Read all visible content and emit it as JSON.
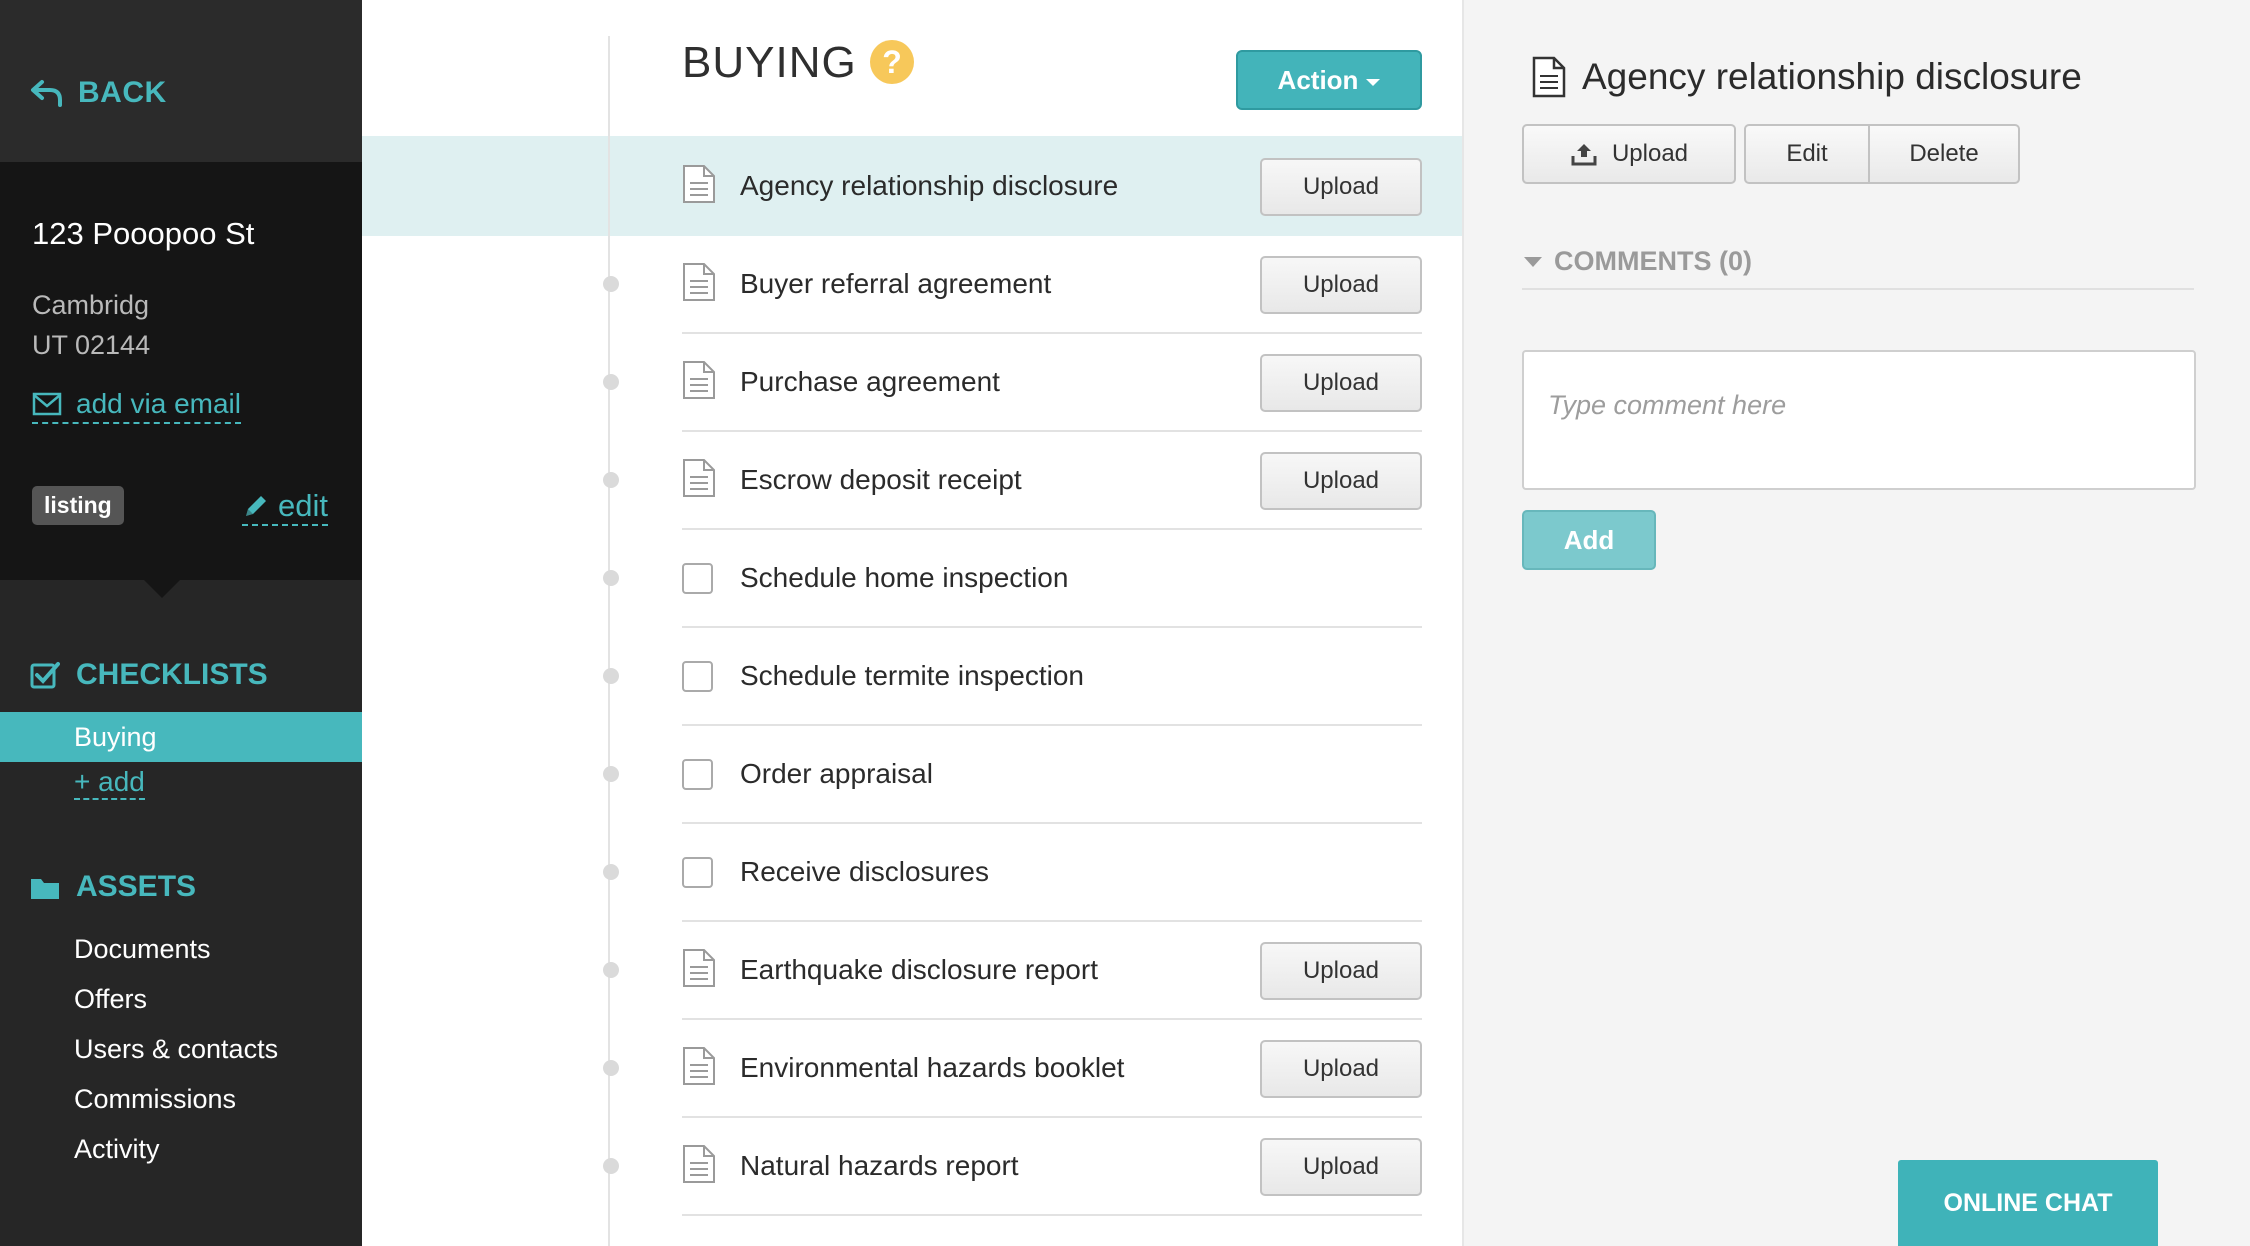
{
  "sidebar": {
    "back_label": "BACK",
    "property": {
      "street": "123 Pooopoo St",
      "city": "Cambridg",
      "state_zip": "UT 02144",
      "email_link": "add via email",
      "badge": "listing",
      "edit_label": "edit"
    },
    "checklists": {
      "title": "CHECKLISTS",
      "items": [
        {
          "label": "Buying",
          "active": true
        }
      ],
      "add_label": "+ add"
    },
    "assets": {
      "title": "ASSETS",
      "items": [
        {
          "label": "Documents"
        },
        {
          "label": "Offers"
        },
        {
          "label": "Users & contacts"
        },
        {
          "label": "Commissions"
        },
        {
          "label": "Activity"
        }
      ]
    }
  },
  "checklist": {
    "title": "BUYING",
    "help_icon": "question-circle-icon",
    "action_label": "Action",
    "upload_label": "Upload",
    "selected_index": 0,
    "items": [
      {
        "label": "Agency relationship disclosure",
        "type": "document"
      },
      {
        "label": "Buyer referral agreement",
        "type": "document"
      },
      {
        "label": "Purchase agreement",
        "type": "document"
      },
      {
        "label": "Escrow deposit receipt",
        "type": "document"
      },
      {
        "label": "Schedule home inspection",
        "type": "task"
      },
      {
        "label": "Schedule termite inspection",
        "type": "task"
      },
      {
        "label": "Order appraisal",
        "type": "task"
      },
      {
        "label": "Receive disclosures",
        "type": "task"
      },
      {
        "label": "Earthquake disclosure report",
        "type": "document"
      },
      {
        "label": "Environmental hazards booklet",
        "type": "document"
      },
      {
        "label": "Natural hazards report",
        "type": "document"
      }
    ]
  },
  "detail": {
    "title": "Agency relationship disclosure",
    "upload_label": "Upload",
    "edit_label": "Edit",
    "delete_label": "Delete",
    "comments_label": "COMMENTS (0)",
    "comment_placeholder": "Type comment here",
    "add_label": "Add"
  },
  "chat": {
    "label": "ONLINE CHAT"
  },
  "colors": {
    "accent": "#47b8bd",
    "sidebar_bg": "#262626",
    "highlight_row": "#dff0f1",
    "help_icon": "#f7c85a"
  }
}
